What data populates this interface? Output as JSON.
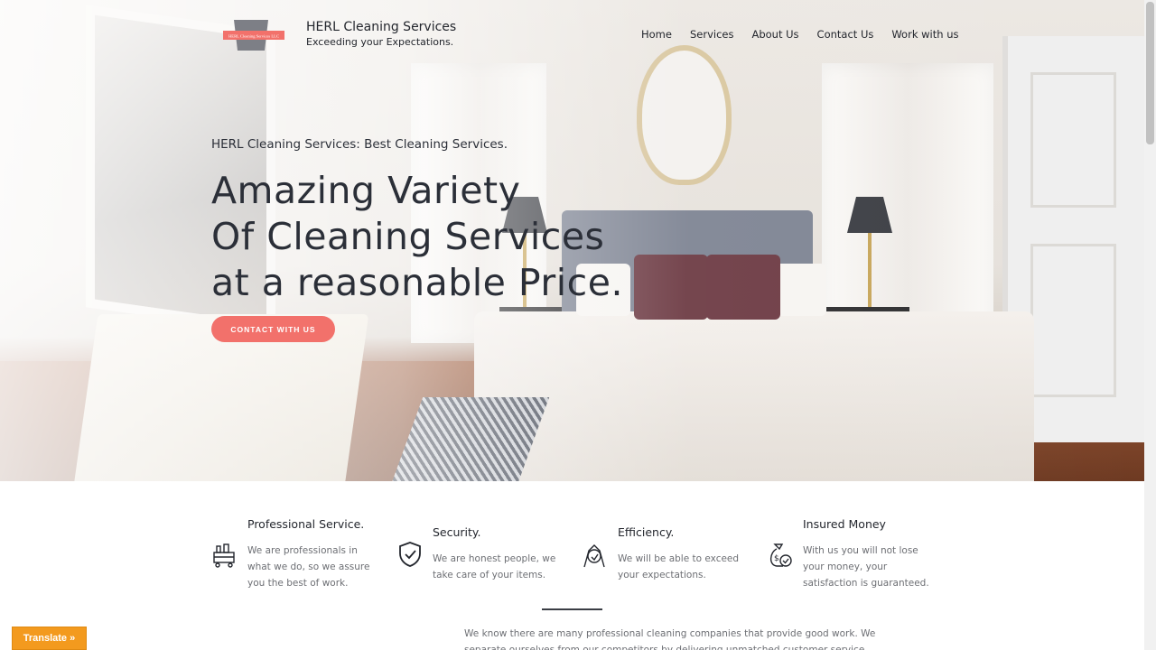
{
  "header": {
    "brand_name": "HERL Cleaning Services",
    "tagline": "Exceeding your Expectations.",
    "logo_text": "HERL Cleaning Services LLC",
    "nav": [
      "Home",
      "Services",
      "About Us",
      "Contact Us",
      "Work with us"
    ]
  },
  "hero": {
    "subtitle": "HERL Cleaning Services: Best Cleaning Services.",
    "title_lines": [
      "Amazing Variety",
      "Of Cleaning Services",
      "at a reasonable Price."
    ],
    "cta_label": "CONTACT WITH US"
  },
  "features": [
    {
      "title": "Professional Service.",
      "text": "We are professionals in what we do, so we assure you the best of work.",
      "icon": "cleaning-cart-icon"
    },
    {
      "title": "Security.",
      "text": "We are honest people, we take care of your items.",
      "icon": "shield-check-icon"
    },
    {
      "title": "Efficiency.",
      "text": "We will be able to exceed your expectations.",
      "icon": "cleaning-person-icon"
    },
    {
      "title": "Insured Money",
      "text": "With us you will not lose your money, your satisfaction is guaranteed.",
      "icon": "money-bag-icon"
    }
  ],
  "intro": "We know there are many professional cleaning companies that provide good work. We separate ourselves from our competitors by delivering unmatched customer service, dependability, and",
  "translate_label": "Translate »",
  "colors": {
    "accent": "#f2716b",
    "text": "#2b2f38",
    "muted": "#6d6f74",
    "translate": "#f39a1e"
  }
}
